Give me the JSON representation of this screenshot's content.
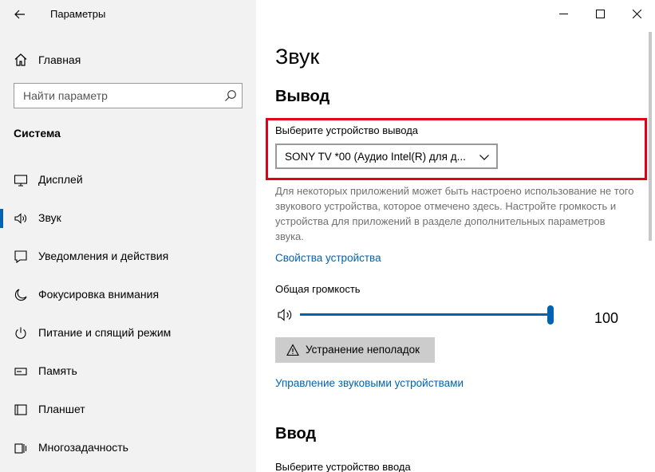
{
  "app": {
    "title": "Параметры"
  },
  "sidebar": {
    "home_label": "Главная",
    "search_placeholder": "Найти параметр",
    "section": "Система",
    "items": [
      {
        "label": "Дисплей",
        "icon": "monitor-icon"
      },
      {
        "label": "Звук",
        "icon": "speaker-icon",
        "active": true
      },
      {
        "label": "Уведомления и действия",
        "icon": "notification-icon"
      },
      {
        "label": "Фокусировка внимания",
        "icon": "moon-icon"
      },
      {
        "label": "Питание и спящий режим",
        "icon": "power-icon"
      },
      {
        "label": "Память",
        "icon": "storage-icon"
      },
      {
        "label": "Планшет",
        "icon": "tablet-icon"
      },
      {
        "label": "Многозадачность",
        "icon": "multitask-icon"
      }
    ]
  },
  "main": {
    "page_title": "Звук",
    "output": {
      "title": "Вывод",
      "device_label": "Выберите устройство вывода",
      "device_value": "SONY TV  *00 (Аудио Intel(R) для д...",
      "description": "Для некоторых приложений может быть настроено использование не того звукового устройства, которое отмечено здесь. Настройте громкость и устройства для приложений в разделе дополнительных параметров звука.",
      "device_properties_link": "Свойства устройства",
      "volume_label": "Общая громкость",
      "volume_value": "100",
      "troubleshoot_label": "Устранение неполадок",
      "manage_devices_link": "Управление звуковыми устройствами"
    },
    "input": {
      "title": "Ввод",
      "device_label": "Выберите устройство ввода"
    }
  },
  "colors": {
    "accent": "#0063b1",
    "highlight": "#e0001a"
  }
}
